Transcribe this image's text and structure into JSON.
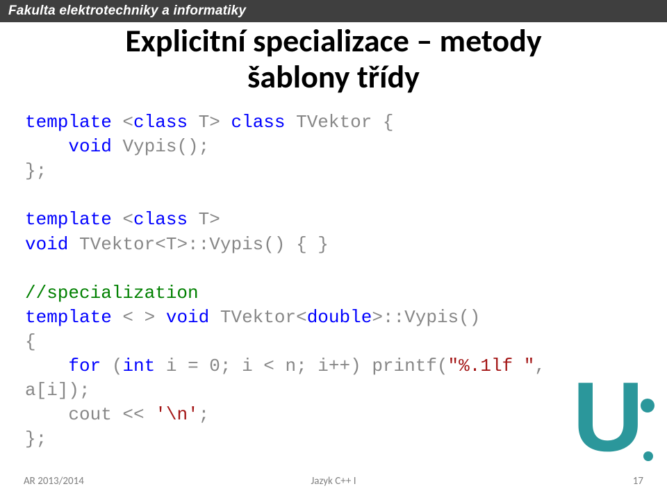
{
  "header": {
    "faculty": "Fakulta elektrotechniky a informatiky"
  },
  "title": {
    "line1": "Explicitní specializace – metody",
    "line2": "šablony třídy"
  },
  "code": {
    "l1a": "template",
    "l1b": " <",
    "l1c": "class",
    "l1d": " T> ",
    "l1e": "class",
    "l1f": " TVektor {",
    "l2a": "    ",
    "l2b": "void",
    "l2c": " Vypis();",
    "l3": "};",
    "blank1": "",
    "l4a": "template",
    "l4b": " <",
    "l4c": "class",
    "l4d": " T>",
    "l5a": "void",
    "l5b": " TVektor<T>::Vypis() { }",
    "blank2": "",
    "l6": "//specialization",
    "l7a": "template",
    "l7b": " < > ",
    "l7c": "void",
    "l7d": " TVektor<",
    "l7e": "double",
    "l7f": ">::Vypis()",
    "l8": "{",
    "l9a": "    ",
    "l9b": "for",
    "l9c": " (",
    "l9d": "int",
    "l9e": " i = 0; i < n; i++) printf(",
    "l9f": "\"%.1lf \"",
    "l9g": ",",
    "l10": "a[i]);",
    "l11a": "    cout << ",
    "l11b": "'\\n'",
    "l11c": ";",
    "l12": "};"
  },
  "footer": {
    "left": "AR 2013/2014",
    "center": "Jazyk C++ I",
    "right": "17"
  }
}
